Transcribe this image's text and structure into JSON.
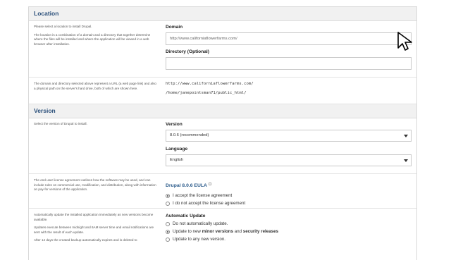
{
  "location": {
    "heading": "Location",
    "intro": "Please select a location to install Drupal.",
    "description": "The location is a combination of a domain and a directory that together determine where the files will be installed and where the application will be viewed in a web browser after installation.",
    "domain_label": "Domain",
    "domain_value": "http://www.californiaflowerfarms.com/",
    "directory_label": "Directory (Optional)",
    "directory_value": "",
    "paths_note": "The domain and directory selected above represent a URL (a web page link) and also a physical path on the server's hard drive, both of which are shown here.",
    "url_path": "http://www.californiaflowerfarms.com/",
    "disk_path": "/home/janepointsman71/public_html/"
  },
  "version": {
    "heading": "Version",
    "intro": "Select the version of Drupal to install.",
    "version_label": "Version",
    "version_value": "8.0.6 (recommended)",
    "language_label": "Language",
    "language_value": "English"
  },
  "eula": {
    "note": "The end user license agreement outlines how the software may be used, and can include rules on commercial use, modification, and distribution, along with information on pay-for versions of the application.",
    "link_label": "Drupal 8.0.6 EULA",
    "accept_label": "I accept the license agreement",
    "decline_label": "I do not accept the license agreement",
    "selected": "accept"
  },
  "auto_update": {
    "note1": "Automatically update the installed application immediately as new versions become available.",
    "note2": "Updates execute between midnight and 6AM server time and email notifications are sent with the result of each update.",
    "note3": "After 14 days the created backup automatically expires and is deleted to",
    "label": "Automatic Update",
    "opt_none": "Do not automatically update.",
    "opt_minor_pre": "Update to new ",
    "opt_minor_bold1": "minor versions",
    "opt_minor_mid": " and ",
    "opt_minor_bold2": "security releases",
    "opt_any": "Update to any new version.",
    "selected": "minor"
  }
}
